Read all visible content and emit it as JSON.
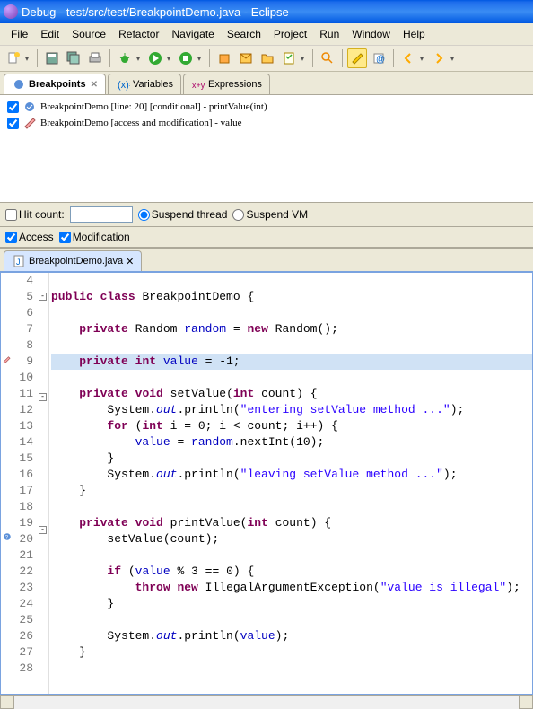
{
  "window": {
    "title": "Debug - test/src/test/BreakpointDemo.java - Eclipse"
  },
  "menu": [
    "File",
    "Edit",
    "Source",
    "Refactor",
    "Navigate",
    "Search",
    "Project",
    "Run",
    "Window",
    "Help"
  ],
  "tabs_top": [
    {
      "label": "Breakpoints",
      "active": true
    },
    {
      "label": "Variables",
      "active": false
    },
    {
      "label": "Expressions",
      "active": false
    }
  ],
  "breakpoints": [
    {
      "checked": true,
      "icon": "line-bp",
      "text": "BreakpointDemo [line: 20] [conditional] - printValue(int)"
    },
    {
      "checked": true,
      "icon": "watch-bp",
      "text": "BreakpointDemo [access and modification] - value"
    }
  ],
  "bp_options": {
    "hit_count_label": "Hit count:",
    "hit_count_checked": false,
    "hit_count_value": "",
    "suspend_thread_label": "Suspend thread",
    "suspend_thread": true,
    "suspend_vm_label": "Suspend VM",
    "suspend_vm": false,
    "access_label": "Access",
    "access": true,
    "modification_label": "Modification",
    "modification": true
  },
  "editor_tab": {
    "label": "BreakpointDemo.java"
  },
  "code_lines": [
    {
      "n": 4,
      "html": ""
    },
    {
      "n": 5,
      "html": "<span class='kw'>public</span> <span class='kw'>class</span> BreakpointDemo {",
      "fold": "-"
    },
    {
      "n": 6,
      "html": ""
    },
    {
      "n": 7,
      "html": "    <span class='kw'>private</span> Random <span class='field'>random</span> = <span class='kw'>new</span> Random();"
    },
    {
      "n": 8,
      "html": ""
    },
    {
      "n": 9,
      "html": "    <span class='kw'>private</span> <span class='kw'>int</span> <span class='field'>value</span> = -1;",
      "hl": true,
      "mark": "watch"
    },
    {
      "n": 10,
      "html": ""
    },
    {
      "n": 11,
      "html": "    <span class='kw'>private</span> <span class='kw'>void</span> setValue(<span class='kw'>int</span> count) {",
      "fold": "-"
    },
    {
      "n": 12,
      "html": "        System.<span class='sfield'>out</span>.println(<span class='str'>\"entering setValue method ...\"</span>);"
    },
    {
      "n": 13,
      "html": "        <span class='kw'>for</span> (<span class='kw'>int</span> i = 0; i &lt; count; i++) {"
    },
    {
      "n": 14,
      "html": "            <span class='field'>value</span> = <span class='field'>random</span>.nextInt(10);"
    },
    {
      "n": 15,
      "html": "        }"
    },
    {
      "n": 16,
      "html": "        System.<span class='sfield'>out</span>.println(<span class='str'>\"leaving setValue method ...\"</span>);"
    },
    {
      "n": 17,
      "html": "    }"
    },
    {
      "n": 18,
      "html": ""
    },
    {
      "n": 19,
      "html": "    <span class='kw'>private</span> <span class='kw'>void</span> printValue(<span class='kw'>int</span> count) {",
      "fold": "-"
    },
    {
      "n": 20,
      "html": "        setValue(count);",
      "mark": "cond-bp"
    },
    {
      "n": 21,
      "html": ""
    },
    {
      "n": 22,
      "html": "        <span class='kw'>if</span> (<span class='field'>value</span> % 3 == 0) {"
    },
    {
      "n": 23,
      "html": "            <span class='kw'>throw</span> <span class='kw'>new</span> IllegalArgumentException(<span class='str'>\"value is illegal\"</span>);"
    },
    {
      "n": 24,
      "html": "        }"
    },
    {
      "n": 25,
      "html": ""
    },
    {
      "n": 26,
      "html": "        System.<span class='sfield'>out</span>.println(<span class='field'>value</span>);"
    },
    {
      "n": 27,
      "html": "    }"
    },
    {
      "n": 28,
      "html": ""
    }
  ]
}
